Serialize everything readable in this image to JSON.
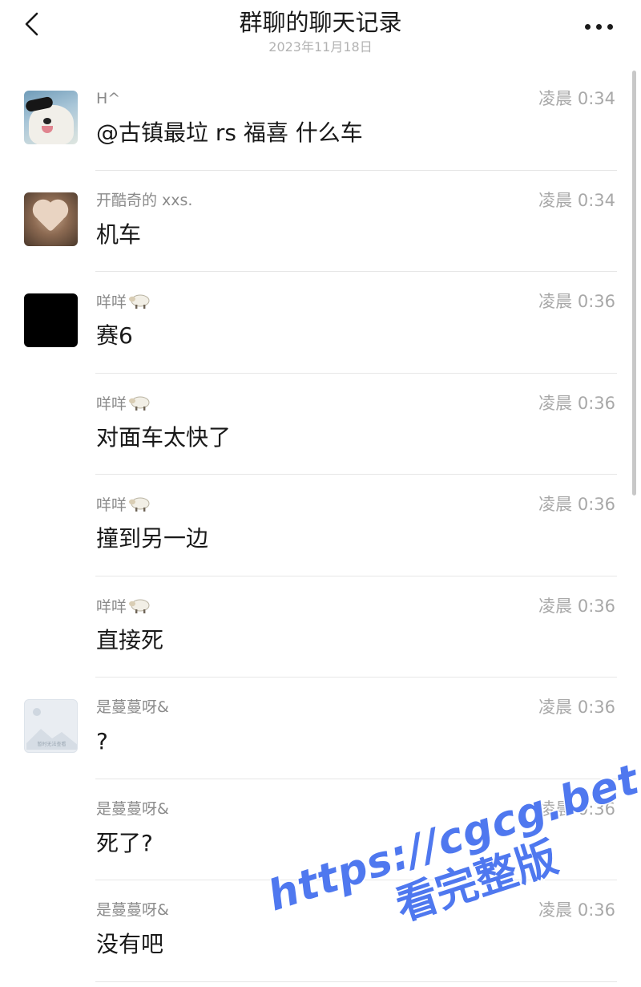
{
  "header": {
    "title": "群聊的聊天记录",
    "subtitle": "2023年11月18日"
  },
  "messages": [
    {
      "sender": "H^",
      "time": "凌晨 0:34",
      "content": "@古镇最垃 rs 福喜 什么车",
      "avatar": "dog-sunglasses-avatar"
    },
    {
      "sender": "开酷奇的 xxs.",
      "time": "凌晨 0:34",
      "content": "机车",
      "avatar": "hands-heart-avatar"
    },
    {
      "sender": "咩咩",
      "time": "凌晨 0:36",
      "content": "赛6",
      "avatar": "black-avatar",
      "sender_icon": "sheep-emoji"
    },
    {
      "sender": "咩咩",
      "time": "凌晨 0:36",
      "content": "对面车太快了",
      "sender_icon": "sheep-emoji"
    },
    {
      "sender": "咩咩",
      "time": "凌晨 0:36",
      "content": "撞到另一边",
      "sender_icon": "sheep-emoji"
    },
    {
      "sender": "咩咩",
      "time": "凌晨 0:36",
      "content": "直接死",
      "sender_icon": "sheep-emoji"
    },
    {
      "sender": "是蔓蔓呀&",
      "time": "凌晨 0:36",
      "content": "?",
      "avatar": "placeholder-avatar",
      "avatar_caption": "暂时无法查看"
    },
    {
      "sender": "是蔓蔓呀&",
      "time": "凌晨 0:36",
      "content": "死了?"
    },
    {
      "sender": "是蔓蔓呀&",
      "time": "凌晨 0:36",
      "content": "没有吧"
    }
  ],
  "watermark": {
    "url": "https://cgcg.bet",
    "caption": "看完整版",
    "color": "#4f78ef"
  }
}
